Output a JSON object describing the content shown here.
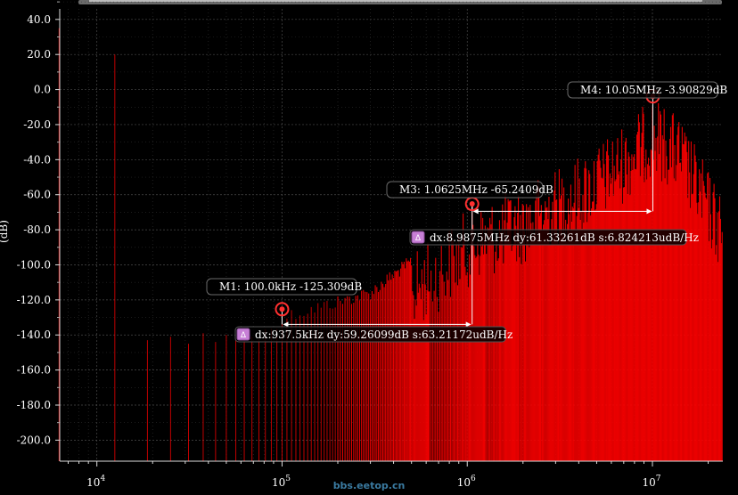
{
  "chart_data": {
    "type": "bar",
    "xscale": "log",
    "xlim": [
      6300,
      24000000
    ],
    "ylim": [
      -212,
      46
    ],
    "ylabel": "(dB)",
    "y_ticks": [
      "40.0",
      "20.0",
      "0.0",
      "-20.0",
      "-40.0",
      "-60.0",
      "-80.0",
      "-100.0",
      "-120.0",
      "-140.0",
      "-160.0",
      "-180.0",
      "-200.0"
    ],
    "y_tick_values": [
      40,
      20,
      0,
      -20,
      -40,
      -60,
      -80,
      -100,
      -120,
      -140,
      -160,
      -180,
      -200
    ],
    "x_ticks": [
      {
        "base": "10",
        "exp": "4",
        "value": 10000
      },
      {
        "base": "10",
        "exp": "5",
        "value": 100000
      },
      {
        "base": "10",
        "exp": "6",
        "value": 1000000
      },
      {
        "base": "10",
        "exp": "7",
        "value": 10000000
      }
    ],
    "grid": true,
    "colors": {
      "bars": "#ff0000",
      "markers": "#ff2a2a",
      "delta": "#ffffff",
      "grid": "#555555"
    },
    "series": [
      {
        "color": "#ff0000",
        "points": [
          {
            "x": 6250,
            "y": 35
          },
          {
            "x": 12500,
            "y": 20
          },
          {
            "x": 18750,
            "y": -143
          },
          {
            "x": 25000,
            "y": -141
          },
          {
            "x": 31250,
            "y": -145
          },
          {
            "x": 37500,
            "y": -139
          },
          {
            "x": 43750,
            "y": -144
          },
          {
            "x": 50000,
            "y": -140
          },
          {
            "x": 56250,
            "y": -142
          },
          {
            "x": 62500,
            "y": -138
          },
          {
            "x": 68750,
            "y": -141
          }
        ]
      }
    ],
    "markers": [
      {
        "id": "M1",
        "label": "M1: 100.0kHz -125.309dB",
        "x": 100000,
        "y": -125.309
      },
      {
        "id": "M3",
        "label": "M3: 1.0625MHz -65.2409dB",
        "x": 1062500,
        "y": -65.2409
      },
      {
        "id": "M4",
        "label": "M4: 10.05MHz -3.90829dB",
        "x": 10050000,
        "y": -3.90829
      }
    ],
    "deltas": [
      {
        "from": "M1",
        "to": "M3",
        "label": "dx:937.5kHz dy:59.26099dB s:63.21172udB/Hz"
      },
      {
        "from": "M3",
        "to": "M4",
        "label": "dx:8.9875MHz dy:61.33261dB s:6.824213udB/Hz"
      }
    ]
  },
  "watermark": "bbs.eetop.cn",
  "delta_icon": "Δ"
}
